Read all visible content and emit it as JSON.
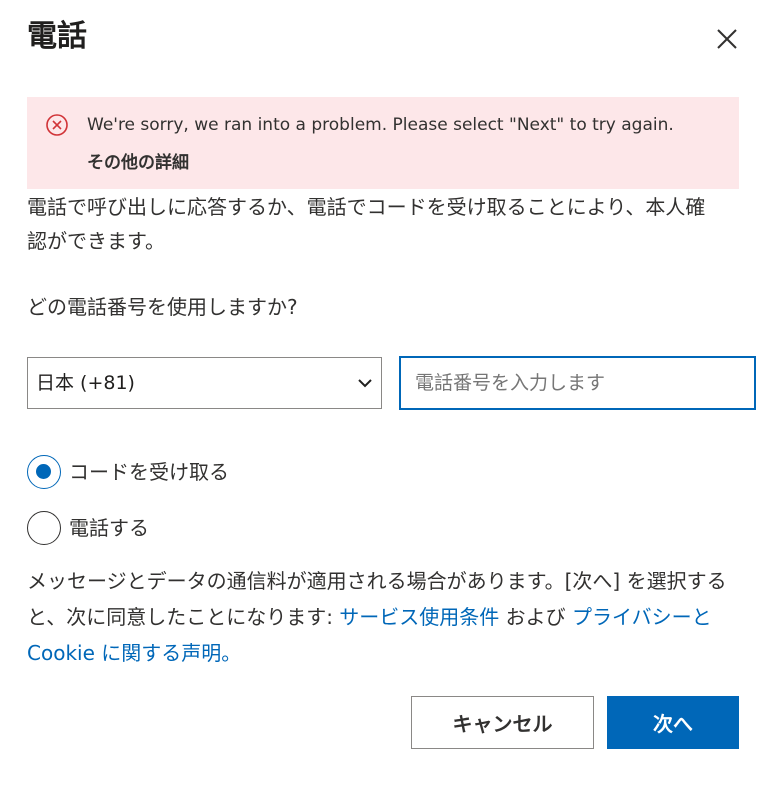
{
  "dialog": {
    "title": "電話",
    "close_icon": "close-icon"
  },
  "error": {
    "icon": "error-circle-x-icon",
    "message": "We're sorry, we ran into a problem. Please select \"Next\" to try again.",
    "details_link": "その他の詳細",
    "background_color": "#fde7e9",
    "icon_color": "#d13438"
  },
  "description": "電話で呼び出しに応答するか、電話でコードを受け取ることにより、本人確認ができます。",
  "question": "どの電話番号を使用しますか?",
  "country_select": {
    "selected": "日本 (+81)",
    "icon": "chevron-down-icon"
  },
  "phone_input": {
    "value": "",
    "placeholder": "電話番号を入力します"
  },
  "options": [
    {
      "label": "コードを受け取る",
      "checked": true
    },
    {
      "label": "電話する",
      "checked": false
    }
  ],
  "disclaimer": {
    "text_before": "メッセージとデータの通信料が適用される場合があります。[次へ] を選択すると、次に同意したことになります: ",
    "terms_link": "サービス使用条件",
    "text_middle": " および ",
    "privacy_link": "プライバシーと Cookie に関する声明。"
  },
  "buttons": {
    "cancel": "キャンセル",
    "next": "次へ"
  },
  "colors": {
    "accent": "#0067b8",
    "text": "#323130"
  }
}
